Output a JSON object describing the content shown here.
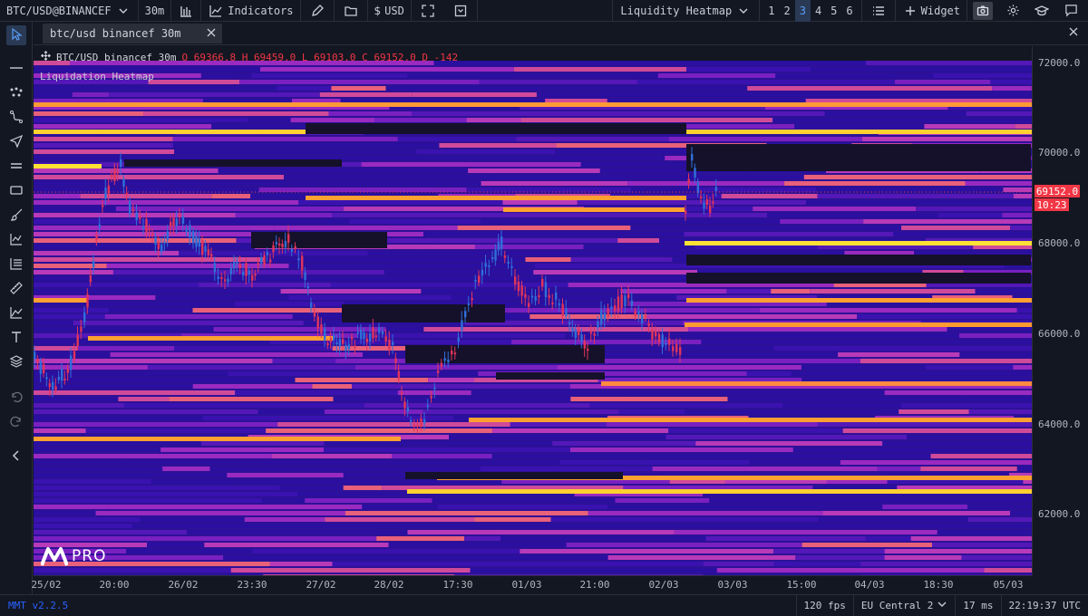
{
  "toolbar": {
    "symbol": "BTC/USD@BINANCEF",
    "timeframe": "30m",
    "indicators_label": "Indicators",
    "currency_label": "USD",
    "heatmap_select": "Liquidity Heatmap",
    "layouts": [
      "1",
      "2",
      "3",
      "4",
      "5",
      "6"
    ],
    "active_layout": "3",
    "widget_label": "Widget"
  },
  "tab": {
    "label": "btc/usd binancef 30m"
  },
  "legend": {
    "symbol": "BTC/USD binancef 30m",
    "open_label": "O",
    "open": "69366.8",
    "high_label": "H",
    "high": "69459.0",
    "low_label": "L",
    "low": "69103.0",
    "close_label": "C",
    "close": "69152.0",
    "delta_label": "D",
    "delta": "-142"
  },
  "indicator_label": "Liquidation Heatmap",
  "watermark_text": "PRO",
  "price_axis": {
    "ticks": [
      "72000.0",
      "70000.0",
      "68000.0",
      "66000.0",
      "64000.0",
      "62000.0"
    ],
    "current_price": "69152.0",
    "countdown": "10:23"
  },
  "time_axis": {
    "ticks": [
      "25/02",
      "20:00",
      "26/02",
      "23:30",
      "27/02",
      "28/02",
      "17:30",
      "01/03",
      "21:00",
      "02/03",
      "03/03",
      "15:00",
      "04/03",
      "18:30",
      "05/03"
    ]
  },
  "status": {
    "version": "MMT v2.2.5",
    "fps": "120 fps",
    "region": "EU Central 2",
    "latency": "17 ms",
    "clock": "22:19:37 UTC"
  },
  "colors": {
    "background": "#131722",
    "heat_low": "#2a0fa0",
    "heat_mid": "#b02fbf",
    "heat_high": "#ff7a45",
    "heat_max": "#ffe135",
    "candle_up": "#2f6fd8",
    "candle_down": "#e0345a",
    "price_badge": "#f23645"
  },
  "icons": [
    "chevron-down-icon",
    "bar-chart-icon",
    "line-chart-icon",
    "pencil-icon",
    "folder-icon",
    "dollar-icon",
    "fullscreen-icon",
    "save-icon",
    "list-icon",
    "plus-icon",
    "camera-icon",
    "gear-icon",
    "graduation-cap-icon",
    "chat-icon",
    "close-icon",
    "cursor-icon",
    "horizontal-line-icon",
    "nodes-icon",
    "path-icon",
    "send-icon",
    "parallel-lines-icon",
    "rectangle-icon",
    "brush-icon",
    "chart-line-icon",
    "fib-icon",
    "ruler-icon",
    "forecast-icon",
    "text-icon",
    "layers-icon",
    "undo-icon",
    "redo-icon",
    "collapse-icon",
    "logo-icon"
  ]
}
